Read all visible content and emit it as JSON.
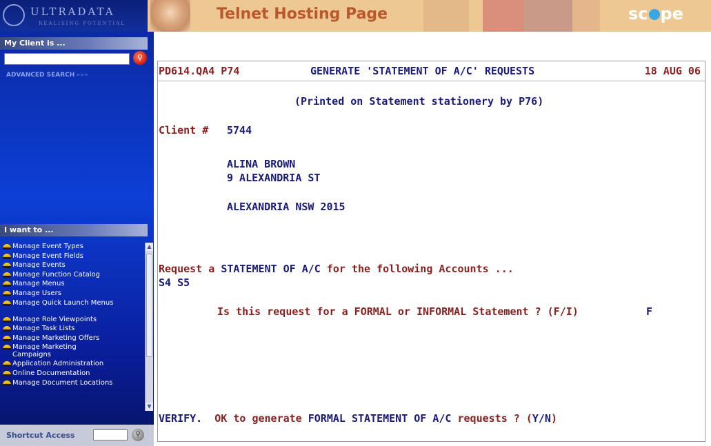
{
  "logo": {
    "name": "ULTRADATA",
    "tagline": "REALISING POTENTIAL"
  },
  "banner": {
    "title": "Telnet Hosting Page",
    "brand_left": "sc",
    "brand_right": "pe"
  },
  "sidebar": {
    "client_header": "My Client is ...",
    "client_input_value": "",
    "advanced_search": "ADVANCED SEARCH",
    "advanced_search_arrows": "»»»",
    "iwant_header": "I want to ...",
    "menu_items": [
      {
        "label": "Manage Event Types"
      },
      {
        "label": "Manage Event Fields"
      },
      {
        "label": "Manage Events"
      },
      {
        "label": "Manage Function Catalog"
      },
      {
        "label": "Manage Menus"
      },
      {
        "label": "Manage Users"
      },
      {
        "label": "Manage Quick Launch Menus"
      },
      {
        "label": "Manage Role Viewpoints"
      },
      {
        "label": "Manage Task Lists"
      },
      {
        "label": "Manage Marketing Offers"
      },
      {
        "label": "Manage Marketing Campaigns"
      },
      {
        "label": "Application Administration"
      },
      {
        "label": "Online Documentation"
      },
      {
        "label": "Manage Document Locations"
      }
    ],
    "shortcut_label": "Shortcut Access",
    "shortcut_input_value": ""
  },
  "terminal": {
    "header_left": "PD614.QA4 P74",
    "header_title": "GENERATE 'STATEMENT OF A/C' REQUESTS",
    "header_date": "18 AUG 06",
    "subtitle": "(Printed on Statement stationery by P76)",
    "client_label": "Client #",
    "client_number": "5744",
    "address_name": "ALINA BROWN",
    "address_street": "9 ALEXANDRIA ST",
    "address_city": "ALEXANDRIA NSW 2015",
    "request_prefix": "Request a ",
    "request_doc": "STATEMENT OF A/C",
    "request_suffix": " for the following Accounts ...",
    "accounts": "S4 S5",
    "formal_question": "Is this request for a FORMAL or INFORMAL Statement ? (F/I)",
    "formal_answer": "F",
    "verify_label": "VERIFY.",
    "verify_prefix": "OK to generate ",
    "verify_doc": "FORMAL STATEMENT OF A/C",
    "verify_suffix": " requests ? (",
    "verify_options": "Y/N",
    "verify_close": ")"
  },
  "colors": {
    "terminal_red": "#8c1f1f",
    "terminal_blue": "#1a1a7a",
    "sidebar_blue": "#0d3fd6",
    "banner": "#eec892"
  }
}
